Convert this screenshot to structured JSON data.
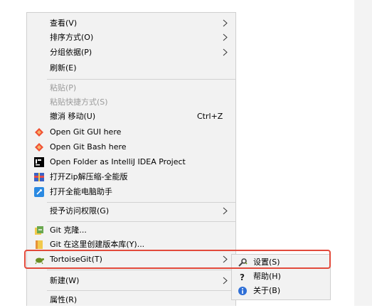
{
  "menu": {
    "view": "查看(V)",
    "sort_by": "排序方式(O)",
    "group_by": "分组依据(P)",
    "refresh": "刷新(E)",
    "paste": "粘贴(P)",
    "paste_shortcut": "粘贴快捷方式(S)",
    "undo_move": "撤消 移动(U)",
    "undo_shortcut": "Ctrl+Z",
    "open_git_gui": "Open Git GUI here",
    "open_git_bash": "Open Git Bash here",
    "open_intellij": "Open Folder as IntelliJ IDEA Project",
    "open_zip": "打开Zip解压缩-全能版",
    "open_assistant": "打开全能电脑助手",
    "grant_access": "授予访问权限(G)",
    "git_clone": "Git 克隆...",
    "git_create_repo": "Git 在这里创建版本库(Y)...",
    "tortoisegit": "TortoiseGit(T)",
    "new": "新建(W)",
    "properties": "属性(R)"
  },
  "submenu": {
    "settings": "设置(S)",
    "help": "帮助(H)",
    "about": "关于(B)"
  },
  "colors": {
    "highlight_border": "#e24a3b",
    "menu_bg": "#f2f2f2"
  }
}
